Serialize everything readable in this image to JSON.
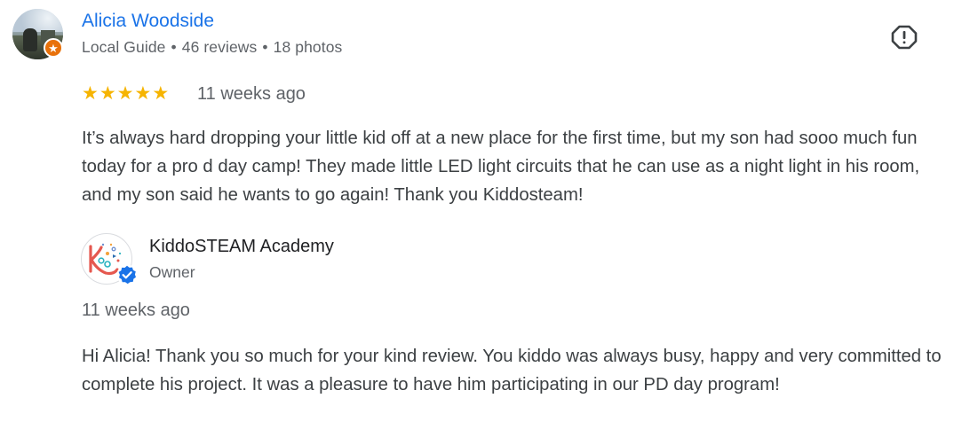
{
  "reviewer": {
    "name": "Alicia Woodside",
    "badge": "Local Guide",
    "reviews": "46 reviews",
    "photos": "18 photos",
    "separator": "•"
  },
  "review": {
    "rating": 5,
    "rating_max": 5,
    "date": "11 weeks ago",
    "text": "It’s always hard dropping your little kid off at a new place for the first time, but my son had sooo much fun today for a pro d day camp! They made little LED light circuits that he can use as a night light in his room, and my son said he wants to go again! Thank you Kiddosteam!"
  },
  "response": {
    "owner_name": "KiddoSTEAM Academy",
    "owner_role": "Owner",
    "date": "11 weeks ago",
    "text": "Hi Alicia! Thank you so much for your kind review. You kiddo was always busy, happy and very committed to complete his project. It was a pleasure to have him participating in our PD day program!"
  },
  "icons": {
    "report": "report-flag-icon",
    "local_guide": "local-guide-star-icon",
    "verified": "verified-check-icon",
    "star": "star-icon"
  },
  "colors": {
    "link": "#1a73e8",
    "star": "#f6b400",
    "local_guide_badge": "#e8710a",
    "verified": "#1a73e8",
    "secondary_text": "#5f6368",
    "body_text": "#3c4043"
  }
}
